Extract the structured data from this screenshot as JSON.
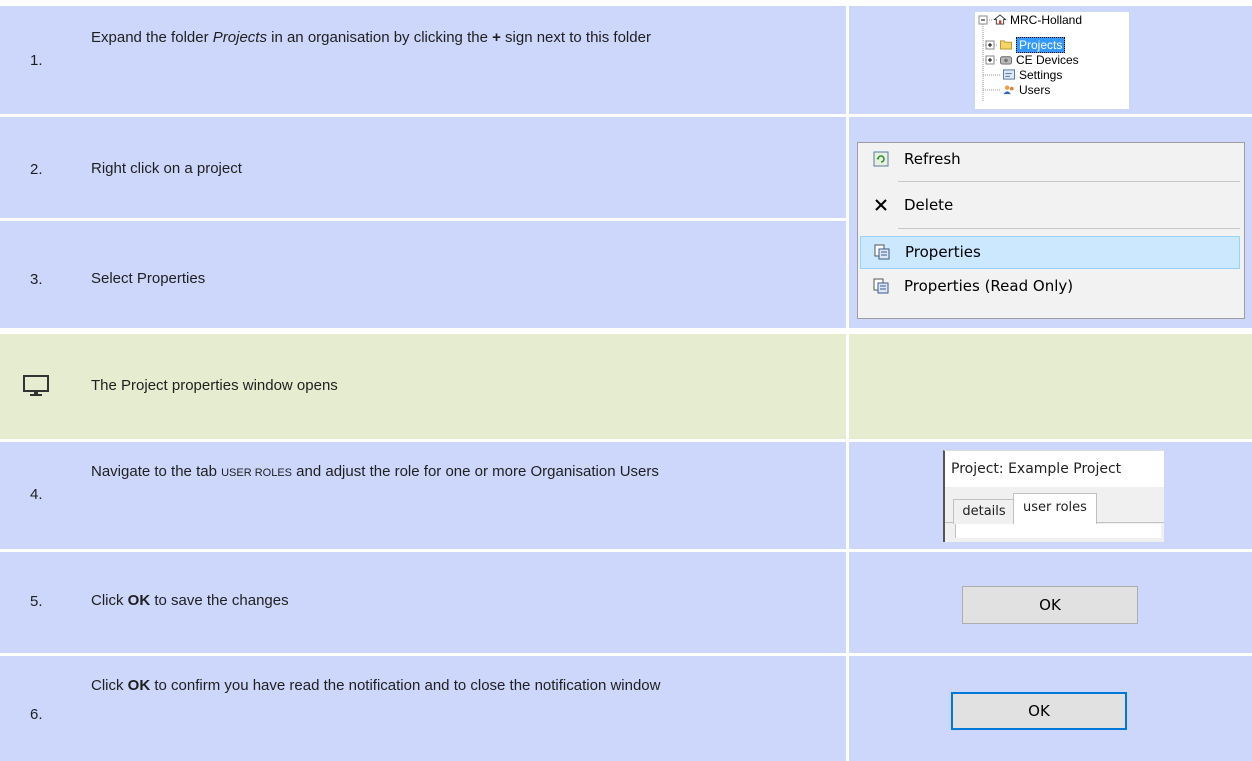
{
  "steps": [
    {
      "num": "1.",
      "text_parts": [
        "Expand the folder ",
        "Projects",
        " in an organisation by clicking the ",
        "+",
        " sign next to this folder"
      ]
    },
    {
      "num": "2.",
      "text": "Right click on a project"
    },
    {
      "num": "3.",
      "text": "Select Properties"
    },
    {
      "num": "",
      "text": "The Project properties window opens",
      "icon": "monitor-icon"
    },
    {
      "num": "4.",
      "text_parts": [
        "Navigate to the tab ",
        "USER ROLES",
        " and adjust the role for one or more Organisation Users"
      ]
    },
    {
      "num": "5.",
      "text_parts": [
        "Click ",
        "OK",
        " to save the changes"
      ]
    },
    {
      "num": "6.",
      "text_parts": [
        "Click ",
        "OK",
        " to confirm you have read the notification and to close the notification window"
      ]
    }
  ],
  "tree": {
    "root": "MRC-Holland",
    "items": [
      "Projects",
      "CE Devices",
      "Settings",
      "Users"
    ]
  },
  "context_menu": {
    "items": [
      "Refresh",
      "Delete",
      "Properties",
      "Properties (Read Only)"
    ],
    "selected": "Properties"
  },
  "project_window": {
    "title": "Project: Example Project",
    "tabs": [
      "details",
      "user roles"
    ]
  },
  "buttons": {
    "ok_label": "OK",
    "ok_focused_label": "OK"
  },
  "colors": {
    "step_bg": "#cdd7fb",
    "info_bg": "#e6ecd0",
    "selection": "#cce8ff",
    "focus_border": "#0078d7"
  }
}
